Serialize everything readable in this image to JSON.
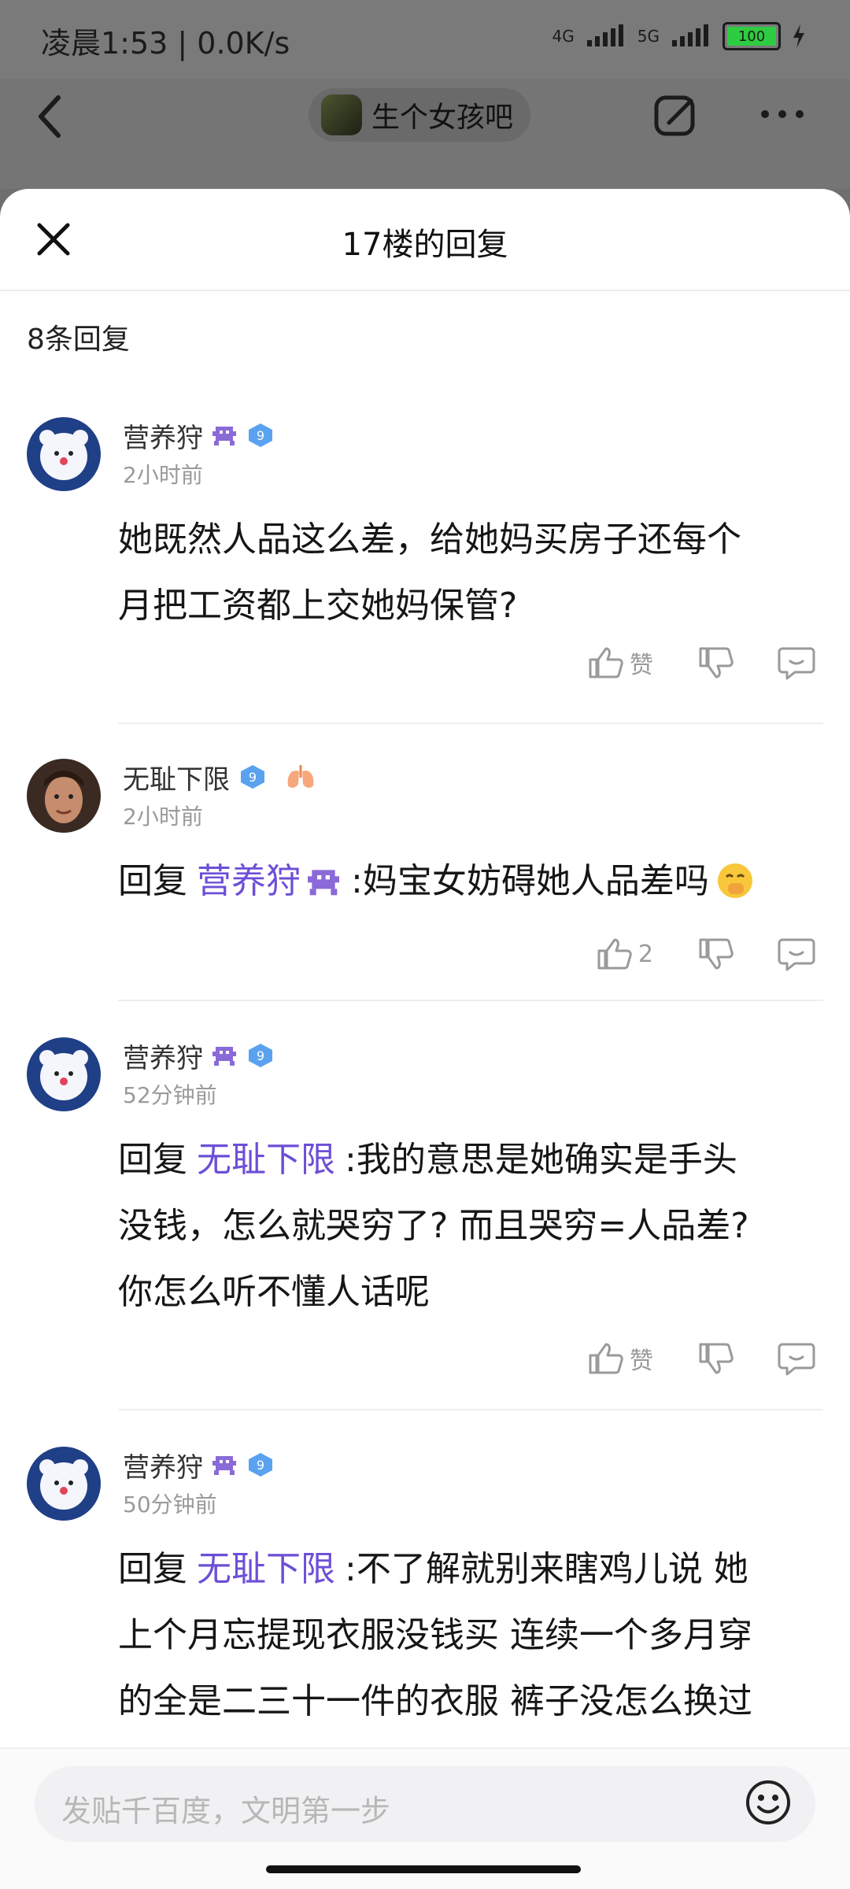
{
  "status_bar": {
    "time": "凌晨1:53 | 0.0K/s",
    "net1": "4G",
    "net2": "5G",
    "battery": "100"
  },
  "top_bar": {
    "forum_name": "生个女孩吧"
  },
  "sheet": {
    "title": "17楼的回复",
    "reply_count": "8条回复"
  },
  "comments": [
    {
      "user": "营养狩",
      "time": "2小时前",
      "lines": [
        "她既然人品这么差，给她妈买房子还每个",
        "月把工资都上交她妈保管?"
      ],
      "like_label": "赞",
      "level": "9"
    },
    {
      "user": "无耻下限",
      "time": "2小时前",
      "reply_prefix": "回复",
      "mention": "营养狩",
      "text": ":妈宝女妨碍她人品差吗",
      "like_label": "2",
      "level": "9"
    },
    {
      "user": "营养狩",
      "time": "52分钟前",
      "reply_prefix": "回复",
      "mention": "无耻下限",
      "line1": ":我的意思是她确实是手头",
      "line2": "没钱，怎么就哭穷了? 而且哭穷=人品差?",
      "line3": "你怎么听不懂人话呢",
      "like_label": "赞",
      "level": "9"
    },
    {
      "user": "营养狩",
      "time": "50分钟前",
      "reply_prefix": "回复",
      "mention": "无耻下限",
      "line1": ":不了解就别来瞎鸡儿说 她",
      "line2": "上个月忘提现衣服没钱买 连续一个多月穿",
      "line3": "的全是二三十一件的衣服 裤子没怎么换过",
      "level": "9"
    }
  ],
  "composer": {
    "placeholder": "发贴千百度，文明第一步"
  },
  "colors": {
    "mention": "#6c4fd6",
    "badge": "#5aa2f0"
  }
}
